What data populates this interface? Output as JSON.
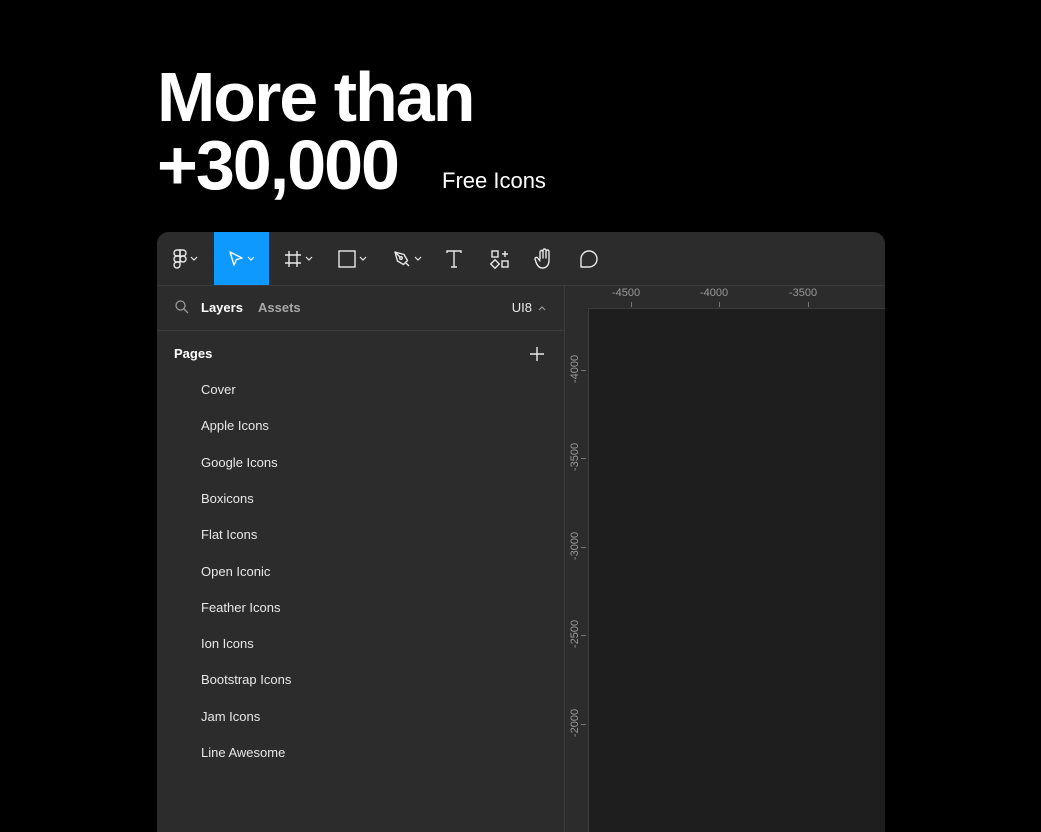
{
  "hero": {
    "line1": "More than",
    "line2": "+30,000",
    "subtitle": "Free Icons"
  },
  "toolbar": {
    "tools": [
      {
        "icon": "figma-main-menu-icon",
        "has_dropdown": true
      },
      {
        "icon": "move-pointer-icon",
        "has_dropdown": true,
        "active": true
      },
      {
        "icon": "frame-grid-icon",
        "has_dropdown": true
      },
      {
        "icon": "rectangle-shape-icon",
        "has_dropdown": true
      },
      {
        "icon": "pen-tool-icon",
        "has_dropdown": true
      },
      {
        "icon": "text-tool-icon",
        "has_dropdown": false
      },
      {
        "icon": "resources-icon",
        "has_dropdown": false
      },
      {
        "icon": "hand-tool-icon",
        "has_dropdown": false
      },
      {
        "icon": "comment-icon",
        "has_dropdown": false
      }
    ],
    "active_color": "#0d99ff"
  },
  "panel": {
    "tabs": {
      "layers": "Layers",
      "assets": "Assets"
    },
    "page_selector": "UI8",
    "pages_heading": "Pages",
    "pages": [
      "Cover",
      "Apple Icons",
      "Google Icons",
      "Boxicons",
      "Flat Icons",
      "Open Iconic",
      "Feather Icons",
      "Ion Icons",
      "Bootstrap Icons",
      "Jam Icons",
      "Line Awesome"
    ]
  },
  "rulers": {
    "horizontal": [
      "-4500",
      "-4000",
      "-3500"
    ],
    "vertical": [
      "-4000",
      "-3500",
      "-3000",
      "-2500",
      "-2000"
    ]
  },
  "colors": {
    "background": "#000000",
    "window": "#2c2c2c",
    "canvas": "#1e1e1e",
    "accent": "#0d99ff"
  }
}
